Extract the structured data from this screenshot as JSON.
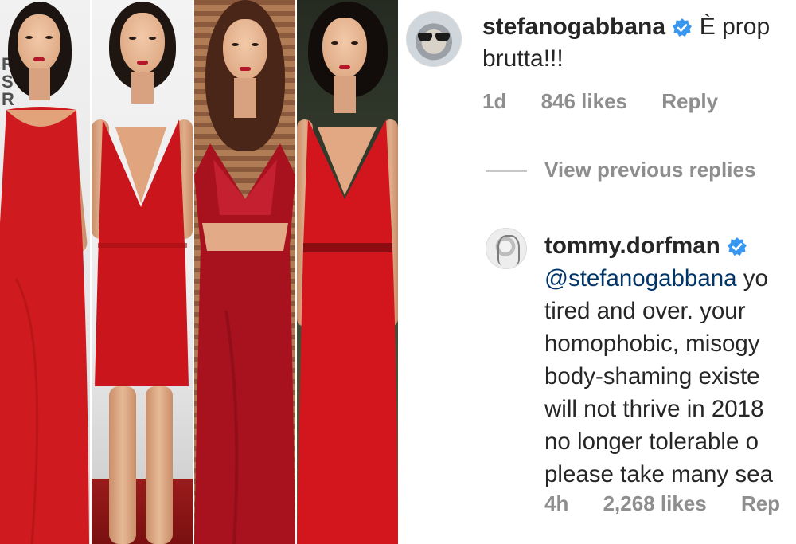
{
  "collage": {
    "backdrop_text_top": "RIC",
    "backdrop_text_mid": "S",
    "backdrop_text_bottom": "R",
    "dress_color": "#c8161d"
  },
  "comments": {
    "first": {
      "username": "stefanogabbana",
      "verified": true,
      "text_line1": "È prop",
      "text_line2": "brutta!!!",
      "age": "1d",
      "likes": "846 likes",
      "reply_label": "Reply"
    },
    "view_previous": "View previous replies",
    "second": {
      "username": "tommy.dorfman",
      "verified": true,
      "mention": "@stefanogabbana",
      "mention_tail": " yo",
      "lines": [
        "tired and over. your",
        "homophobic, misogy",
        "body-shaming existe",
        "will not thrive in 2018",
        "no longer tolerable o",
        "please take many sea"
      ],
      "age": "4h",
      "likes": "2,268 likes",
      "reply_label": "Rep"
    }
  },
  "colors": {
    "verified_blue": "#3897f0",
    "meta_gray": "#8e8e8e",
    "text_dark": "#262626"
  }
}
